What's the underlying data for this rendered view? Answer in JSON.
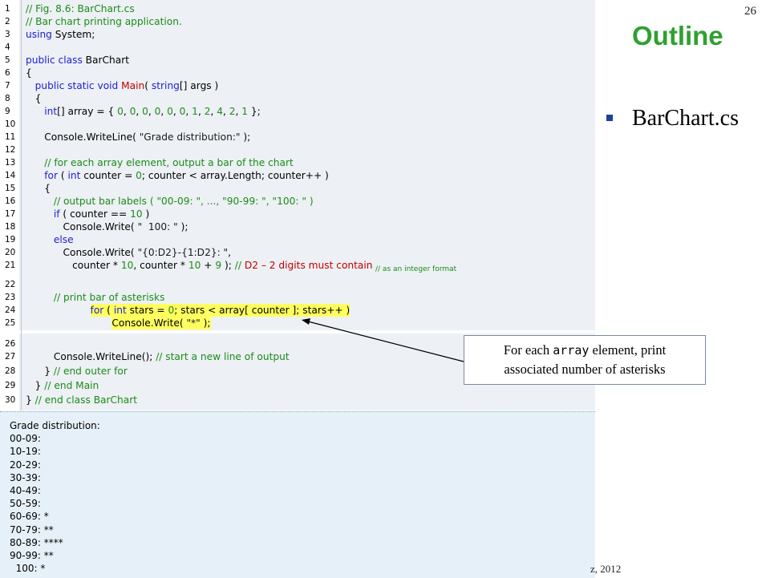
{
  "code": {
    "lines": [
      {
        "num": "1",
        "segs": [
          {
            "t": "// Fig. 8.6: BarChart.cs",
            "c": "cmt"
          }
        ]
      },
      {
        "num": "2",
        "segs": [
          {
            "t": "// Bar chart printing application.",
            "c": "cmt"
          }
        ]
      },
      {
        "num": "3",
        "segs": [
          {
            "t": "using",
            "c": "kw"
          },
          {
            "t": " System;",
            "c": ""
          }
        ]
      },
      {
        "num": "4",
        "segs": []
      },
      {
        "num": "5",
        "segs": [
          {
            "t": "public class",
            "c": "kw"
          },
          {
            "t": " BarChart",
            "c": ""
          }
        ]
      },
      {
        "num": "6",
        "segs": [
          {
            "t": "{",
            "c": ""
          }
        ]
      },
      {
        "num": "7",
        "segs": [
          {
            "t": "   ",
            "c": ""
          },
          {
            "t": "public static void",
            "c": "kw"
          },
          {
            "t": " ",
            "c": ""
          },
          {
            "t": "Main",
            "c": "red"
          },
          {
            "t": "( ",
            "c": ""
          },
          {
            "t": "string",
            "c": "kw"
          },
          {
            "t": "[] args )",
            "c": ""
          }
        ]
      },
      {
        "num": "8",
        "segs": [
          {
            "t": "   {",
            "c": ""
          }
        ]
      },
      {
        "num": "9",
        "segs": [
          {
            "t": "      ",
            "c": ""
          },
          {
            "t": "int",
            "c": "kw"
          },
          {
            "t": "[] array = { ",
            "c": ""
          },
          {
            "t": "0",
            "c": "num"
          },
          {
            "t": ", ",
            "c": ""
          },
          {
            "t": "0",
            "c": "num"
          },
          {
            "t": ", ",
            "c": ""
          },
          {
            "t": "0",
            "c": "num"
          },
          {
            "t": ", ",
            "c": ""
          },
          {
            "t": "0",
            "c": "num"
          },
          {
            "t": ", ",
            "c": ""
          },
          {
            "t": "0",
            "c": "num"
          },
          {
            "t": ", ",
            "c": ""
          },
          {
            "t": "0",
            "c": "num"
          },
          {
            "t": ", ",
            "c": ""
          },
          {
            "t": "1",
            "c": "num"
          },
          {
            "t": ", ",
            "c": ""
          },
          {
            "t": "2",
            "c": "num"
          },
          {
            "t": ", ",
            "c": ""
          },
          {
            "t": "4",
            "c": "num"
          },
          {
            "t": ", ",
            "c": ""
          },
          {
            "t": "2",
            "c": "num"
          },
          {
            "t": ", ",
            "c": ""
          },
          {
            "t": "1",
            "c": "num"
          },
          {
            "t": " };",
            "c": ""
          }
        ]
      },
      {
        "num": "10",
        "segs": []
      },
      {
        "num": "11",
        "segs": [
          {
            "t": "      Console.WriteLine( ",
            "c": ""
          },
          {
            "t": "\"Grade distribution:\"",
            "c": "str"
          },
          {
            "t": " );",
            "c": ""
          }
        ]
      },
      {
        "num": "12",
        "segs": []
      },
      {
        "num": "13",
        "segs": [
          {
            "t": "      ",
            "c": ""
          },
          {
            "t": "// for each array element, output a bar of the chart",
            "c": "cmt"
          }
        ]
      },
      {
        "num": "14",
        "segs": [
          {
            "t": "      ",
            "c": ""
          },
          {
            "t": "for",
            "c": "kw"
          },
          {
            "t": " ( ",
            "c": ""
          },
          {
            "t": "int",
            "c": "kw"
          },
          {
            "t": " counter = ",
            "c": ""
          },
          {
            "t": "0",
            "c": "num"
          },
          {
            "t": "; counter < array.Length; counter++ )",
            "c": ""
          }
        ]
      },
      {
        "num": "15",
        "segs": [
          {
            "t": "      {",
            "c": ""
          }
        ]
      },
      {
        "num": "16",
        "segs": [
          {
            "t": "         ",
            "c": ""
          },
          {
            "t": "// output bar labels ( \"00-09: \", ..., \"90-99: \", \"100: \" )",
            "c": "cmt"
          }
        ]
      },
      {
        "num": "17",
        "segs": [
          {
            "t": "         ",
            "c": ""
          },
          {
            "t": "if",
            "c": "kw"
          },
          {
            "t": " ( counter == ",
            "c": ""
          },
          {
            "t": "10",
            "c": "num"
          },
          {
            "t": " )",
            "c": ""
          }
        ]
      },
      {
        "num": "18",
        "segs": [
          {
            "t": "            Console.Write( ",
            "c": ""
          },
          {
            "t": "\"  100: \"",
            "c": "str"
          },
          {
            "t": " );",
            "c": ""
          }
        ]
      },
      {
        "num": "19",
        "segs": [
          {
            "t": "         ",
            "c": ""
          },
          {
            "t": "else",
            "c": "kw"
          }
        ]
      },
      {
        "num": "20",
        "segs": [
          {
            "t": "            Console.Write( ",
            "c": ""
          },
          {
            "t": "\"{0:D2}-{1:D2}: \"",
            "c": "str"
          },
          {
            "t": ",",
            "c": ""
          }
        ]
      },
      {
        "num": "21",
        "segs": [
          {
            "t": "               counter * ",
            "c": ""
          },
          {
            "t": "10",
            "c": "num"
          },
          {
            "t": ", counter * ",
            "c": ""
          },
          {
            "t": "10",
            "c": "num"
          },
          {
            "t": " + ",
            "c": ""
          },
          {
            "t": "9",
            "c": "num"
          },
          {
            "t": " ); ",
            "c": ""
          },
          {
            "t": "// ",
            "c": "cmt"
          },
          {
            "t": "D2 – 2 digits must contain",
            "c": "red"
          }
        ]
      },
      {
        "num": "22",
        "segs": []
      },
      {
        "num": "23",
        "segs": [
          {
            "t": "         ",
            "c": ""
          },
          {
            "t": "// print bar of asterisks",
            "c": "cmt"
          }
        ]
      },
      {
        "num": "24",
        "segs": [
          {
            "t": "for",
            "c": "kw"
          },
          {
            "t": " ( ",
            "c": ""
          },
          {
            "t": "int",
            "c": "kw"
          },
          {
            "t": " stars = ",
            "c": ""
          },
          {
            "t": "0",
            "c": "num"
          },
          {
            "t": "; stars < array[ counter ]; stars++ )",
            "c": ""
          }
        ],
        "hl": true,
        "indent": "         "
      },
      {
        "num": "25",
        "segs": [
          {
            "t": "Console.Write( ",
            "c": ""
          },
          {
            "t": "\"*\"",
            "c": "str"
          },
          {
            "t": " );",
            "c": ""
          }
        ],
        "hl": true,
        "indent": "            "
      },
      {
        "num": "26",
        "segs": []
      },
      {
        "num": "27",
        "segs": [
          {
            "t": "         Console.WriteLine(); ",
            "c": ""
          },
          {
            "t": "// start a new line of output",
            "c": "cmt"
          }
        ]
      },
      {
        "num": "28",
        "segs": [
          {
            "t": "      } ",
            "c": ""
          },
          {
            "t": "// end outer for",
            "c": "cmt"
          }
        ]
      },
      {
        "num": "29",
        "segs": [
          {
            "t": "   } ",
            "c": ""
          },
          {
            "t": "// end Main",
            "c": "cmt"
          }
        ]
      },
      {
        "num": "30",
        "segs": [
          {
            "t": "} ",
            "c": ""
          },
          {
            "t": "// end class BarChart",
            "c": "cmt"
          }
        ]
      }
    ],
    "note": "// as an integer format"
  },
  "output": {
    "lines": [
      "Grade distribution:",
      "00-09:",
      "10-19:",
      "20-29:",
      "30-39:",
      "40-49:",
      "50-59:",
      "60-69: *",
      "70-79: **",
      "80-89: ****",
      "90-99: **",
      "  100: *"
    ]
  },
  "slide": {
    "number": "26",
    "title": "Outline",
    "bullet": "BarChart.cs",
    "copyright": "z, 2012"
  },
  "callout": {
    "prefix": "For each ",
    "mono": "array",
    "suffix": " element, print",
    "line2": "associated number of asterisks"
  },
  "colors": {
    "title_green": "#30a030",
    "bullet_blue": "#1d3f9e",
    "code_bg": "#edf0f4",
    "highlight": "#ffff60"
  }
}
